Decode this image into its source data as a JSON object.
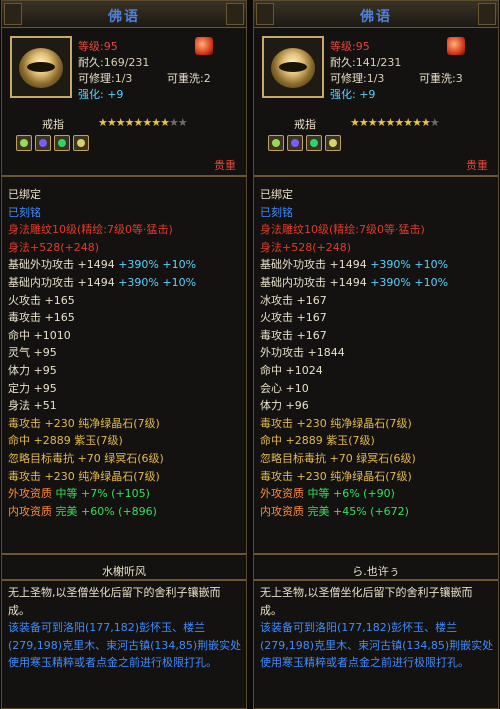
{
  "panels": [
    {
      "title": "佛语",
      "level_label": "等级",
      "level_value": ":95",
      "durability_label": "耐久",
      "durability_value": ":169/231",
      "repair_label": "可修理",
      "repair_value": ":1/3",
      "rewash_label": "可重洗",
      "rewash_value": ":2",
      "enhance_label": "强化",
      "enhance_value": ": +9",
      "item_type": "戒指",
      "stars_total": 10,
      "stars_filled": 8,
      "precious": "贵重",
      "lines": [
        {
          "parts": [
            {
              "t": "已绑定",
              "c": "lbl"
            }
          ]
        },
        {
          "parts": [
            {
              "t": "已刻铭",
              "c": "blue"
            }
          ]
        },
        {
          "parts": [
            {
              "t": "身法雕纹10级(精绘:7级0等·猛击)",
              "c": "red"
            }
          ]
        },
        {
          "parts": [
            {
              "t": "身法+528(+248)",
              "c": "red"
            }
          ]
        },
        {
          "parts": [
            {
              "t": "基础外功攻击 +1494 ",
              "c": "lbl"
            },
            {
              "t": "+390% +10%",
              "c": "cyan"
            }
          ]
        },
        {
          "parts": [
            {
              "t": "基础内功攻击 +1494 ",
              "c": "lbl"
            },
            {
              "t": "+390% +10%",
              "c": "cyan"
            }
          ]
        },
        {
          "parts": [
            {
              "t": "火攻击 +165",
              "c": "lbl"
            }
          ]
        },
        {
          "parts": [
            {
              "t": "毒攻击 +165",
              "c": "lbl"
            }
          ]
        },
        {
          "parts": [
            {
              "t": "命中 +1010",
              "c": "lbl"
            }
          ]
        },
        {
          "parts": [
            {
              "t": "灵气 +95",
              "c": "lbl"
            }
          ]
        },
        {
          "parts": [
            {
              "t": "体力 +95",
              "c": "lbl"
            }
          ]
        },
        {
          "parts": [
            {
              "t": "定力 +95",
              "c": "lbl"
            }
          ]
        },
        {
          "parts": [
            {
              "t": "身法 +51",
              "c": "lbl"
            }
          ]
        },
        {
          "parts": [
            {
              "t": "毒攻击 +230 纯净绿晶石(7级)",
              "c": "gold"
            }
          ]
        },
        {
          "parts": [
            {
              "t": "命中 +2889 紫玉(7级)",
              "c": "gold"
            }
          ]
        },
        {
          "parts": [
            {
              "t": "忽略目标毒抗 +70 绿冥石(6级)",
              "c": "gold"
            }
          ]
        },
        {
          "parts": [
            {
              "t": "毒攻击 +230 纯净绿晶石(7级)",
              "c": "gold"
            }
          ]
        },
        {
          "parts": [
            {
              "t": "外攻资质 ",
              "c": "orange"
            },
            {
              "t": "中等 +7% (+105)",
              "c": "green"
            }
          ]
        },
        {
          "parts": [
            {
              "t": "内攻资质 ",
              "c": "orange"
            },
            {
              "t": "完美 +60% (+896)",
              "c": "green"
            }
          ]
        }
      ],
      "owner": "水榭听风",
      "description": [
        {
          "t": "无上圣物,以圣僧坐化后留下的舍利子镶嵌而成。",
          "c": "lbl"
        },
        {
          "t": "该装备可到洛阳(177,182)彭怀玉、楼兰(279,198)克里木、束河古镇(134,85)荆嵌实处使用寒玉精粹或者点金之前进行极限打孔。",
          "c": "blue"
        }
      ]
    },
    {
      "title": "佛语",
      "level_label": "等级",
      "level_value": ":95",
      "durability_label": "耐久",
      "durability_value": ":141/231",
      "repair_label": "可修理",
      "repair_value": ":1/3",
      "rewash_label": "可重洗",
      "rewash_value": ":3",
      "enhance_label": "强化",
      "enhance_value": ": +9",
      "item_type": "戒指",
      "stars_total": 10,
      "stars_filled": 9,
      "precious": "贵重",
      "lines": [
        {
          "parts": [
            {
              "t": "已绑定",
              "c": "lbl"
            }
          ]
        },
        {
          "parts": [
            {
              "t": "已刻铭",
              "c": "blue"
            }
          ]
        },
        {
          "parts": [
            {
              "t": "身法雕纹10级(精绘:7级0等·猛击)",
              "c": "red"
            }
          ]
        },
        {
          "parts": [
            {
              "t": "身法+528(+248)",
              "c": "red"
            }
          ]
        },
        {
          "parts": [
            {
              "t": "基础外功攻击 +1494 ",
              "c": "lbl"
            },
            {
              "t": "+390% +10%",
              "c": "cyan"
            }
          ]
        },
        {
          "parts": [
            {
              "t": "基础内功攻击 +1494 ",
              "c": "lbl"
            },
            {
              "t": "+390% +10%",
              "c": "cyan"
            }
          ]
        },
        {
          "parts": [
            {
              "t": "冰攻击 +167",
              "c": "lbl"
            }
          ]
        },
        {
          "parts": [
            {
              "t": "火攻击 +167",
              "c": "lbl"
            }
          ]
        },
        {
          "parts": [
            {
              "t": "毒攻击 +167",
              "c": "lbl"
            }
          ]
        },
        {
          "parts": [
            {
              "t": "外功攻击 +1844",
              "c": "lbl"
            }
          ]
        },
        {
          "parts": [
            {
              "t": "命中 +1024",
              "c": "lbl"
            }
          ]
        },
        {
          "parts": [
            {
              "t": "会心 +10",
              "c": "lbl"
            }
          ]
        },
        {
          "parts": [
            {
              "t": "体力 +96",
              "c": "lbl"
            }
          ]
        },
        {
          "parts": [
            {
              "t": "毒攻击 +230 纯净绿晶石(7级)",
              "c": "gold"
            }
          ]
        },
        {
          "parts": [
            {
              "t": "命中 +2889 紫玉(7级)",
              "c": "gold"
            }
          ]
        },
        {
          "parts": [
            {
              "t": "忽略目标毒抗 +70 绿冥石(6级)",
              "c": "gold"
            }
          ]
        },
        {
          "parts": [
            {
              "t": "毒攻击 +230 纯净绿晶石(7级)",
              "c": "gold"
            }
          ]
        },
        {
          "parts": [
            {
              "t": "外攻资质 ",
              "c": "orange"
            },
            {
              "t": "中等 +6% (+90)",
              "c": "green"
            }
          ]
        },
        {
          "parts": [
            {
              "t": "内攻资质 ",
              "c": "orange"
            },
            {
              "t": "完美 +45% (+672)",
              "c": "green"
            }
          ]
        }
      ],
      "owner": "ら.也许ぅ",
      "description": [
        {
          "t": "无上圣物,以圣僧坐化后留下的舍利子镶嵌而成。",
          "c": "lbl"
        },
        {
          "t": "该装备可到洛阳(177,182)彭怀玉、楼兰(279,198)克里木、束河古镇(134,85)荆嵌实处使用寒玉精粹或者点金之前进行极限打孔。",
          "c": "blue"
        }
      ]
    }
  ],
  "gem_colors": [
    "#9ad85a",
    "#7a5cff",
    "#2fd36a",
    "#d8d06a"
  ]
}
